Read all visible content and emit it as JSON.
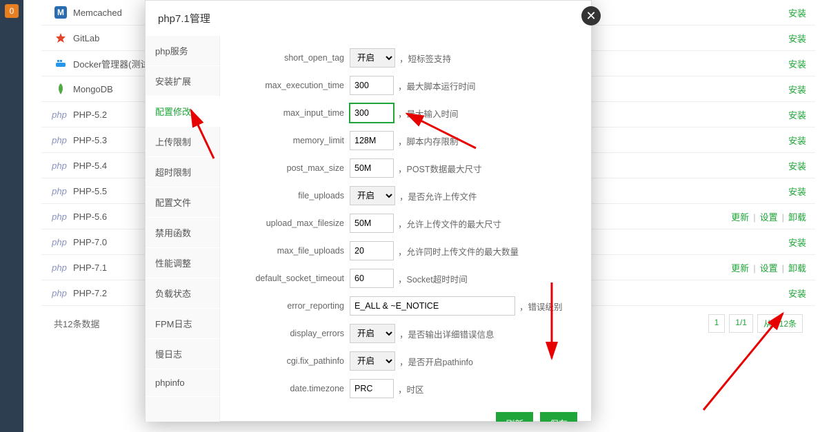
{
  "leftbar": {
    "badge": "0"
  },
  "software": [
    {
      "icon": "memcached",
      "name": "Memcached",
      "install": "安装"
    },
    {
      "icon": "gitlab",
      "name": "GitLab",
      "install": "安装"
    },
    {
      "icon": "docker",
      "name": "Docker管理器(测试版)",
      "install": "安装"
    },
    {
      "icon": "mongodb",
      "name": "MongoDB",
      "install": "安装"
    },
    {
      "icon": "php",
      "name": "PHP-5.2",
      "install": "安装"
    },
    {
      "icon": "php",
      "name": "PHP-5.3",
      "install": "安装"
    },
    {
      "icon": "php",
      "name": "PHP-5.4",
      "install": "安装"
    },
    {
      "icon": "php",
      "name": "PHP-5.5",
      "install": "安装"
    },
    {
      "icon": "php",
      "name": "PHP-5.6",
      "update": "更新",
      "set": "设置",
      "uninstall": "卸载",
      "controls": true
    },
    {
      "icon": "php",
      "name": "PHP-7.0",
      "install": "安装"
    },
    {
      "icon": "php",
      "name": "PHP-7.1",
      "update": "更新",
      "set": "设置",
      "uninstall": "卸载",
      "controls": true
    },
    {
      "icon": "php",
      "name": "PHP-7.2",
      "install": "安装"
    }
  ],
  "pager": {
    "summary": "共12条数据",
    "page_cur": "1",
    "page_total": "1/1",
    "range": "从1-12条"
  },
  "modal": {
    "title": "php7.1管理",
    "tabs": [
      "php服务",
      "安装扩展",
      "配置修改",
      "上传限制",
      "超时限制",
      "配置文件",
      "禁用函数",
      "性能调整",
      "负载状态",
      "FPM日志",
      "慢日志",
      "phpinfo"
    ],
    "active_tab_index": 2,
    "fields": [
      {
        "label": "short_open_tag",
        "type": "select",
        "value": "开启",
        "desc": "，短标签支持"
      },
      {
        "label": "max_execution_time",
        "type": "text",
        "value": "300",
        "desc": "，最大脚本运行时间"
      },
      {
        "label": "max_input_time",
        "type": "text",
        "value": "300",
        "desc": "，最大输入时间",
        "focused": true
      },
      {
        "label": "memory_limit",
        "type": "text",
        "value": "128M",
        "desc": "，脚本内存限制"
      },
      {
        "label": "post_max_size",
        "type": "text",
        "value": "50M",
        "desc": "，POST数据最大尺寸"
      },
      {
        "label": "file_uploads",
        "type": "select",
        "value": "开启",
        "desc": "，是否允许上传文件"
      },
      {
        "label": "upload_max_filesize",
        "type": "text",
        "value": "50M",
        "desc": "，允许上传文件的最大尺寸"
      },
      {
        "label": "max_file_uploads",
        "type": "text",
        "value": "20",
        "desc": "，允许同时上传文件的最大数量"
      },
      {
        "label": "default_socket_timeout",
        "type": "text",
        "value": "60",
        "desc": "，Socket超时时间"
      },
      {
        "label": "error_reporting",
        "type": "text",
        "value": "E_ALL & ~E_NOTICE",
        "desc": "，错误级别",
        "wide": true
      },
      {
        "label": "display_errors",
        "type": "select",
        "value": "开启",
        "desc": "，是否输出详细错误信息"
      },
      {
        "label": "cgi.fix_pathinfo",
        "type": "select",
        "value": "开启",
        "desc": "，是否开启pathinfo"
      },
      {
        "label": "date.timezone",
        "type": "text",
        "value": "PRC",
        "desc": "，时区"
      }
    ],
    "btn_refresh": "刷新",
    "btn_save": "保存"
  }
}
